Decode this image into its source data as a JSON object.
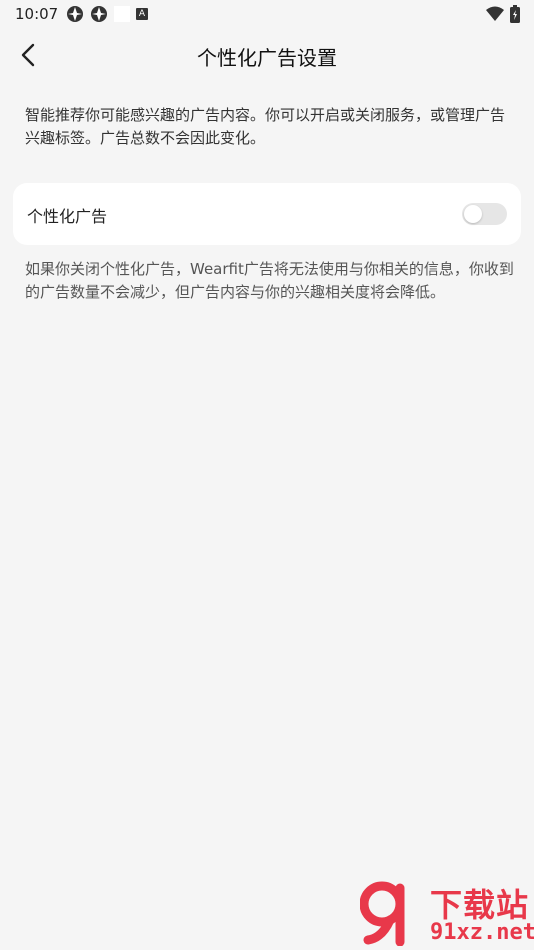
{
  "status_bar": {
    "time": "10:07",
    "icons": [
      "app-notification-icon",
      "app-notification-icon",
      "blank-notification-icon",
      "keyboard-a-icon"
    ],
    "a_icon_text": "A",
    "right_icons": [
      "wifi-icon",
      "battery-icon"
    ]
  },
  "toolbar": {
    "title": "个性化广告设置"
  },
  "intro": {
    "text": "智能推荐你可能感兴趣的广告内容。你可以开启或关闭服务，或管理广告兴趣标签。广告总数不会因此变化。"
  },
  "setting_card": {
    "label": "个性化广告",
    "toggle_on": false
  },
  "note": {
    "text": "如果你关闭个性化广告，Wearfit广告将无法使用与你相关的信息，你收到的广告数量不会减少，但广告内容与你的兴趣相关度将会降低。"
  },
  "watermark": {
    "line1": "下载站",
    "line2": "91xz.net",
    "color": "#e8384a"
  }
}
